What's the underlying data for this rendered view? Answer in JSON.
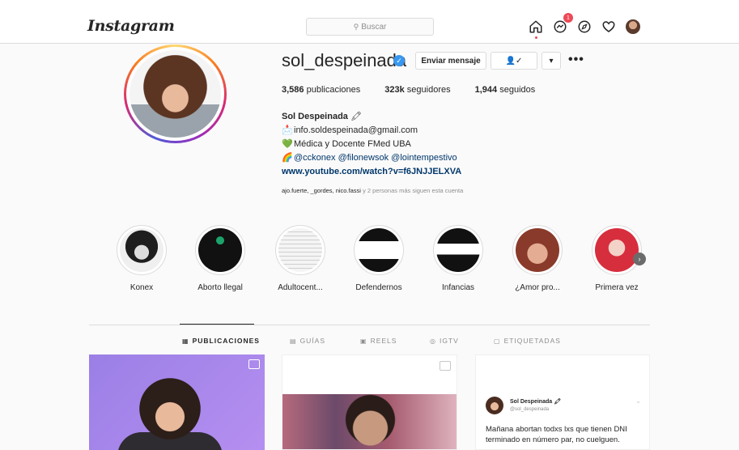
{
  "nav": {
    "logo": "Instagram",
    "search_placeholder": "Buscar",
    "notifications_count": "1",
    "icons": [
      "home-icon",
      "messenger-icon",
      "explore-icon",
      "heart-icon",
      "avatar"
    ]
  },
  "profile": {
    "username": "sol_despeinada",
    "verified_glyph": "✓",
    "message_button": "Enviar mensaje",
    "follow_button": "👤✓",
    "dropdown_button": "▾",
    "more_button": "•••",
    "stats": {
      "posts_count": "3,586",
      "posts_label": "publicaciones",
      "followers_count": "323k",
      "followers_label": "seguidores",
      "following_count": "1,944",
      "following_label": "seguidos"
    },
    "bio": {
      "name": "Sol Despeinada",
      "name_emoji": "🖍",
      "email_icon": "📩",
      "email": "info.soldespeinada@gmail.com",
      "line2_icon": "💚",
      "line2": "Médica y Docente FMed UBA",
      "line3_icon": "🌈",
      "line3": "@cckonex @filonewsok @lointempestivo",
      "url": "www.youtube.com/watch?v=f6JNJJELXVA"
    },
    "followed_by_names": "ajo.fuerte, _gordes, nico.fassi",
    "followed_by_rest": " y 2 personas más siguen esta cuenta"
  },
  "highlights": [
    {
      "label": "Konex"
    },
    {
      "label": "Aborto llegal"
    },
    {
      "label": "Adultocent..."
    },
    {
      "label": "Defendernos"
    },
    {
      "label": "Infancias"
    },
    {
      "label": "¿Amor pro..."
    },
    {
      "label": "Primera vez"
    }
  ],
  "highlight_next": "›",
  "tabs": [
    {
      "icon": "▦",
      "label": "PUBLICACIONES"
    },
    {
      "icon": "▤",
      "label": "GUÍAS"
    },
    {
      "icon": "▣",
      "label": "REELS"
    },
    {
      "icon": "◎",
      "label": "IGTV"
    },
    {
      "icon": "▢",
      "label": "ETIQUETADAS"
    }
  ],
  "posts": {
    "tweet_name": "Sol Despeinada 🖍",
    "tweet_handle": "@sol_despeinada",
    "tweet_text": "Mañana abortan todxs lxs que tienen DNI terminado en número par, no cuelguen.",
    "tweet_chevron": "⌄"
  }
}
